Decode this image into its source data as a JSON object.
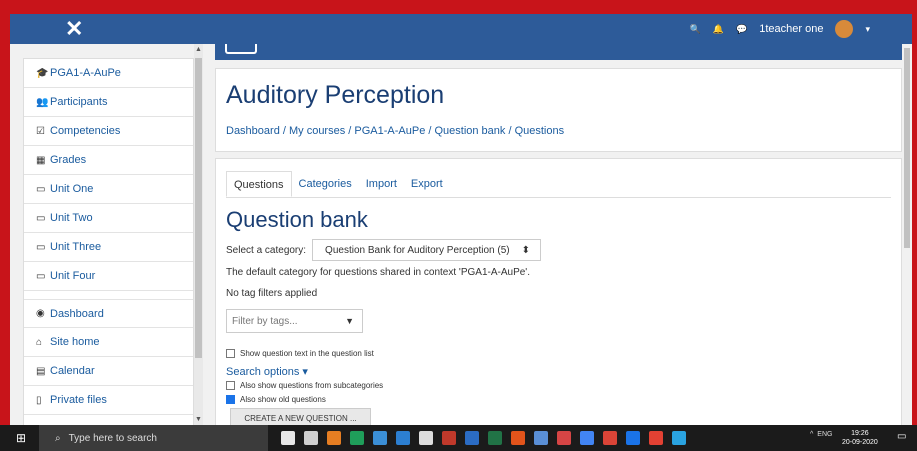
{
  "navbar": {
    "close_glyph": "✕",
    "user_name": "1teacher one",
    "search_glyph": "🔍",
    "bell_glyph": "🔔",
    "chat_glyph": "💬",
    "caret": "▾"
  },
  "sidebar": {
    "items": [
      {
        "label": "PGA1-A-AuPe",
        "icon": "graduation-cap-icon",
        "glyph": "🎓"
      },
      {
        "label": "Participants",
        "icon": "users-icon",
        "glyph": "👥"
      },
      {
        "label": "Competencies",
        "icon": "checklist-icon",
        "glyph": "☑"
      },
      {
        "label": "Grades",
        "icon": "table-icon",
        "glyph": "▦"
      },
      {
        "label": "Unit One",
        "icon": "folder-icon",
        "glyph": "▭"
      },
      {
        "label": "Unit Two",
        "icon": "folder-icon",
        "glyph": "▭"
      },
      {
        "label": "Unit Three",
        "icon": "folder-icon",
        "glyph": "▭"
      },
      {
        "label": "Unit Four",
        "icon": "folder-icon",
        "glyph": "▭"
      },
      {
        "label": "Dashboard",
        "icon": "dashboard-icon",
        "glyph": "◉"
      },
      {
        "label": "Site home",
        "icon": "home-icon",
        "glyph": "⌂"
      },
      {
        "label": "Calendar",
        "icon": "calendar-icon",
        "glyph": "▤"
      },
      {
        "label": "Private files",
        "icon": "file-icon",
        "glyph": "▯"
      }
    ]
  },
  "header": {
    "course_title": "Auditory Perception",
    "breadcrumb": "Dashboard / My courses /  PGA1-A-AuPe /  Question bank /  Questions"
  },
  "tabs": [
    {
      "label": "Questions",
      "active": true
    },
    {
      "label": "Categories",
      "active": false
    },
    {
      "label": "Import",
      "active": false
    },
    {
      "label": "Export",
      "active": false
    }
  ],
  "main": {
    "title": "Question bank",
    "category_label": "Select a category:",
    "category_value": "Question Bank for Auditory Perception (5)",
    "select_caret": "⬍",
    "description": "The default category for questions shared in context 'PGA1-A-AuPe'.",
    "no_tag": "No tag filters applied",
    "tag_placeholder": "Filter by tags...",
    "tag_caret": "▼",
    "show_text_label": "Show question text in the question list",
    "show_text_checked": false,
    "search_options": "Search options ▾",
    "subcat_label": "Also show questions from subcategories",
    "subcat_checked": false,
    "old_label": "Also show old questions",
    "old_checked": true,
    "create_button": "CREATE A NEW QUESTION ..."
  },
  "taskbar": {
    "search_placeholder": "Type here to search",
    "lang": "ENG",
    "time": "19:26",
    "date": "20-09-2020",
    "app_colors": [
      "#e8e8e8",
      "#d0d0d0",
      "#e67e22",
      "#1f9e5a",
      "#3b8fd6",
      "#2c7fd1",
      "#dddddd",
      "#c0392b",
      "#2b6cc4",
      "#217346",
      "#e2541b",
      "#5a8fd6",
      "#d64545",
      "#4285f4",
      "#db4437",
      "#1a73e8",
      "#e34133",
      "#2aa3e0"
    ]
  }
}
